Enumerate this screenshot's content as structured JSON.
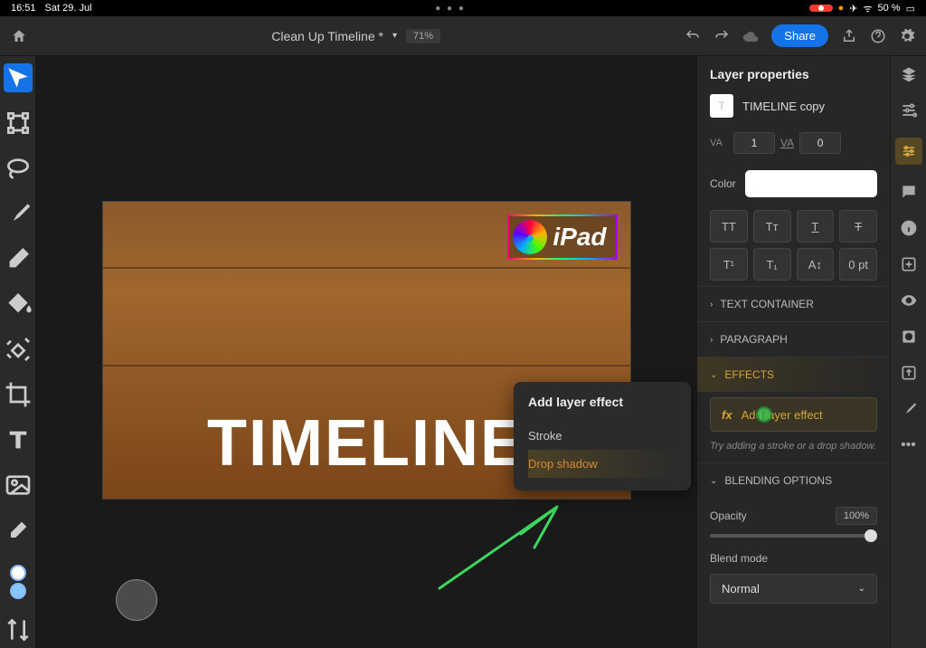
{
  "status": {
    "time": "16:51",
    "date": "Sat 29. Jul",
    "battery": "50 %"
  },
  "topbar": {
    "title": "Clean Up Timeline *",
    "zoom": "71%",
    "share": "Share"
  },
  "canvas": {
    "badge_text": "iPad",
    "main_text": "TIMELINE"
  },
  "popover": {
    "title": "Add layer effect",
    "item_stroke": "Stroke",
    "item_drop_shadow": "Drop shadow"
  },
  "panel": {
    "header": "Layer properties",
    "layer_name": "TIMELINE copy",
    "tracking_label": "VA",
    "tracking_value": "1",
    "baseline_label": "VA",
    "baseline_value": "0",
    "color_label": "Color",
    "pt_value": "0 pt",
    "section_text_container": "TEXT CONTAINER",
    "section_paragraph": "PARAGRAPH",
    "section_effects": "EFFECTS",
    "add_effect": "Add layer effect",
    "hint": "Try adding a stroke or a drop shadow.",
    "section_blending": "BLENDING OPTIONS",
    "opacity_label": "Opacity",
    "opacity_value": "100%",
    "blend_label": "Blend mode",
    "blend_value": "Normal"
  }
}
